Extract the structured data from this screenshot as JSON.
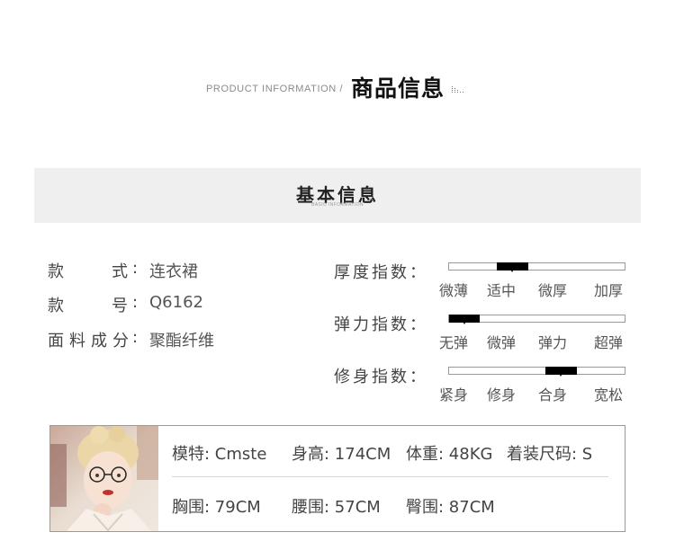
{
  "header": {
    "english": "PRODUCT INFORMATION /",
    "chinese": "商品信息"
  },
  "basic_info": {
    "title": "基本信息",
    "subtitle": "BASIC INFORMATION"
  },
  "specs": [
    {
      "label_chars": [
        "款",
        "式"
      ],
      "value": "连衣裙"
    },
    {
      "label_chars": [
        "款",
        "号"
      ],
      "value": "Q6162"
    },
    {
      "label_chars": [
        "面",
        "料",
        "成",
        "分"
      ],
      "value": "聚酯纤维"
    }
  ],
  "indices": [
    {
      "label": "厚度指数：",
      "options": [
        "微薄",
        "适中",
        "微厚",
        "加厚"
      ],
      "selected": "适中",
      "selected_index": 1
    },
    {
      "label": "弹力指数：",
      "options": [
        "无弹",
        "微弹",
        "弹力",
        "超弹"
      ],
      "selected": "无弹",
      "selected_index": 0
    },
    {
      "label": "修身指数：",
      "options": [
        "紧身",
        "修身",
        "合身",
        "宽松"
      ],
      "selected": "合身",
      "selected_index": 2
    }
  ],
  "model": {
    "name": "模特: Cmste",
    "height": "身高: 174CM",
    "weight": "体重: 48KG",
    "size": "着装尺码: S",
    "bust": "胸围: 79CM",
    "waist": "腰围: 57CM",
    "hip": "臀围: 87CM"
  },
  "colors": {
    "bar_fill": "#000000",
    "band_bg": "#efefef",
    "text": "#444444"
  }
}
